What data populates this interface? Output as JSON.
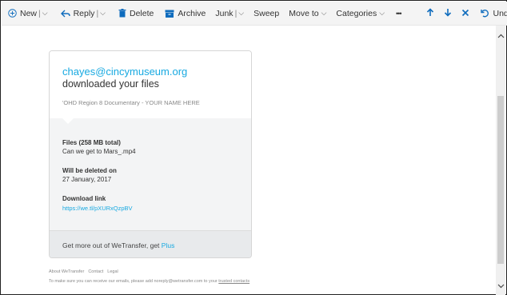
{
  "toolbar": {
    "new_label": "New",
    "reply_label": "Reply",
    "delete_label": "Delete",
    "archive_label": "Archive",
    "junk_label": "Junk",
    "sweep_label": "Sweep",
    "move_label": "Move to",
    "categories_label": "Categories",
    "more_label": "•••",
    "undo_label": "Undo",
    "separator": "|",
    "chevron": "⌵"
  },
  "email": {
    "sender": "chayes@cincymuseum.org",
    "headline": "downloaded your files",
    "subject": "'OHD Region 8 Documentary - YOUR NAME HERE",
    "files_label": "Files (258 MB total)",
    "files_value": "Can we get to Mars_.mp4",
    "deleted_label": "Will be deleted on",
    "deleted_value": "27 January, 2017",
    "download_label": "Download link",
    "download_url": "https://we.tl/pXURxQzpBV",
    "promo_text": "Get more out of WeTransfer, get ",
    "promo_link": "Plus"
  },
  "footer": {
    "links": [
      "About WeTransfer",
      "Contact",
      "Legal"
    ],
    "note_prefix": "To make sure you can receive our emails, please add noreply@wetransfer.com to your ",
    "note_link": "trusted contacts"
  },
  "colors": {
    "accent": "#0f6cbd",
    "wetransfer_blue": "#17a9e1"
  }
}
